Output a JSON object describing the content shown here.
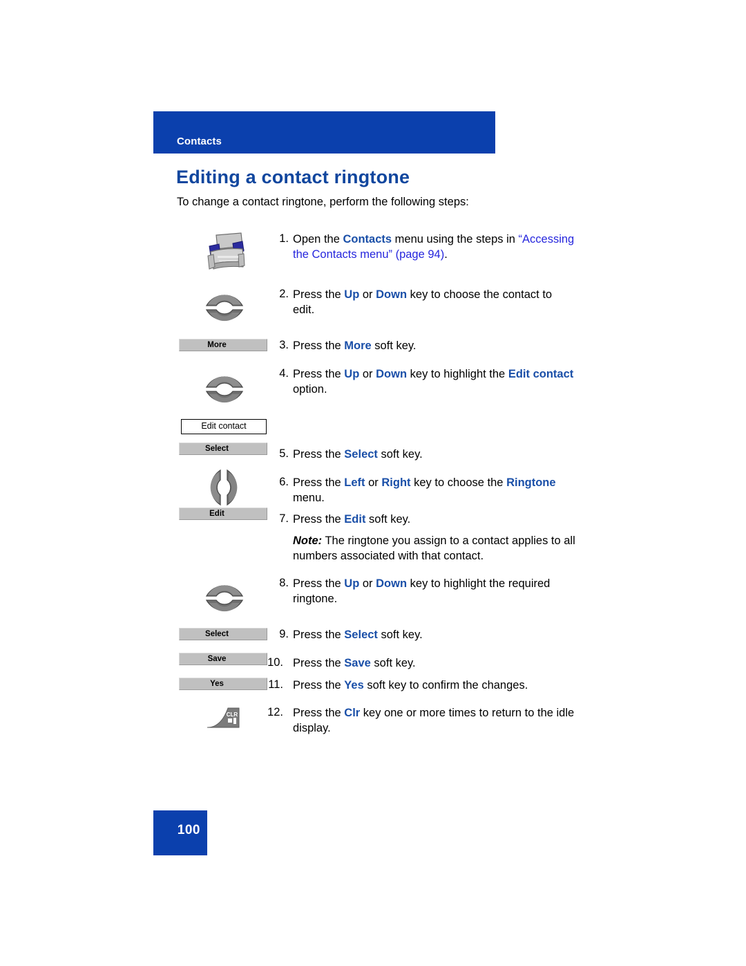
{
  "header": {
    "running_title": "Contacts",
    "bar_color": "#0b40ad"
  },
  "heading": {
    "title": "Editing a contact ringtone",
    "color": "#10469e"
  },
  "intro": "To change a contact ringtone, perform the following steps:",
  "colors": {
    "accent_blue": "#0b40ad",
    "keyword_blue": "#1a4fa8",
    "xref_blue": "#2626dd",
    "softkey_gray": "#c0c0c0",
    "key_art_gray": "#767676"
  },
  "steps": [
    {
      "number": "1.",
      "icon": "rolodex-icon",
      "text_parts": [
        {
          "t": "Open the ",
          "s": "plain"
        },
        {
          "t": "Contacts",
          "s": "bold"
        },
        {
          "t": " menu using the steps in ",
          "s": "plain"
        },
        {
          "t": "“Accessing the Contacts menu” (page 94)",
          "s": "xref"
        },
        {
          "t": ".",
          "s": "plain"
        }
      ]
    },
    {
      "number": "2.",
      "icon": "up-down-navigation-key-icon",
      "text_parts": [
        {
          "t": "Press the ",
          "s": "plain"
        },
        {
          "t": "Up",
          "s": "bold"
        },
        {
          "t": " or ",
          "s": "plain"
        },
        {
          "t": "Down",
          "s": "bold"
        },
        {
          "t": " key to choose the contact to edit.",
          "s": "plain"
        }
      ]
    },
    {
      "number": "3.",
      "icon": "softkey-more",
      "softkey_label": "More",
      "text_parts": [
        {
          "t": "Press the ",
          "s": "plain"
        },
        {
          "t": "More",
          "s": "bold"
        },
        {
          "t": " soft key.",
          "s": "plain"
        }
      ]
    },
    {
      "number": "4.",
      "icon": "up-down-navigation-key-icon",
      "menubox_label": "Edit contact",
      "text_parts": [
        {
          "t": "Press the ",
          "s": "plain"
        },
        {
          "t": "Up",
          "s": "bold"
        },
        {
          "t": " or ",
          "s": "plain"
        },
        {
          "t": "Down",
          "s": "bold"
        },
        {
          "t": " key to highlight the ",
          "s": "plain"
        },
        {
          "t": "Edit contact",
          "s": "bold"
        },
        {
          "t": " option.",
          "s": "plain"
        }
      ]
    },
    {
      "number": "5.",
      "icon": "softkey-select",
      "softkey_label": "Select",
      "text_parts": [
        {
          "t": "Press the ",
          "s": "plain"
        },
        {
          "t": "Select",
          "s": "bold"
        },
        {
          "t": " soft key.",
          "s": "plain"
        }
      ]
    },
    {
      "number": "6.",
      "icon": "left-right-navigation-key-icon",
      "text_parts": [
        {
          "t": "Press the ",
          "s": "plain"
        },
        {
          "t": "Left",
          "s": "bold"
        },
        {
          "t": " or ",
          "s": "plain"
        },
        {
          "t": "Right",
          "s": "bold"
        },
        {
          "t": " key to choose the ",
          "s": "plain"
        },
        {
          "t": "Ringtone",
          "s": "bold"
        },
        {
          "t": " menu.",
          "s": "plain"
        }
      ]
    },
    {
      "number": "7.",
      "icon": "softkey-edit",
      "softkey_label": "Edit",
      "text_parts": [
        {
          "t": "Press the ",
          "s": "plain"
        },
        {
          "t": "Edit",
          "s": "bold"
        },
        {
          "t": " soft key.",
          "s": "plain"
        }
      ]
    },
    {
      "number": "8.",
      "icon": "up-down-navigation-key-icon",
      "text_parts": [
        {
          "t": "Press the ",
          "s": "plain"
        },
        {
          "t": "Up",
          "s": "bold"
        },
        {
          "t": " or ",
          "s": "plain"
        },
        {
          "t": "Down",
          "s": "bold"
        },
        {
          "t": " key to highlight the required ringtone.",
          "s": "plain"
        }
      ]
    },
    {
      "number": "9.",
      "icon": "softkey-select",
      "softkey_label": "Select",
      "text_parts": [
        {
          "t": "Press the ",
          "s": "plain"
        },
        {
          "t": "Select",
          "s": "bold"
        },
        {
          "t": " soft key.",
          "s": "plain"
        }
      ]
    },
    {
      "number": "10.",
      "icon": "softkey-save",
      "softkey_label": "Save",
      "text_parts": [
        {
          "t": "Press the ",
          "s": "plain"
        },
        {
          "t": "Save",
          "s": "bold"
        },
        {
          "t": " soft key.",
          "s": "plain"
        }
      ]
    },
    {
      "number": "11.",
      "icon": "softkey-yes",
      "softkey_label": "Yes",
      "text_parts": [
        {
          "t": "Press the ",
          "s": "plain"
        },
        {
          "t": "Yes",
          "s": "bold"
        },
        {
          "t": " soft key to confirm the changes.",
          "s": "plain"
        }
      ]
    },
    {
      "number": "12.",
      "icon": "clr-key-icon",
      "key_label": "CLR",
      "text_parts": [
        {
          "t": "Press the ",
          "s": "plain"
        },
        {
          "t": "Clr",
          "s": "bold"
        },
        {
          "t": " key one or more times to return to the idle display.",
          "s": "plain"
        }
      ]
    }
  ],
  "note": {
    "lead": "Note:",
    "body": " The ringtone you assign to a contact applies to all numbers associated with that contact."
  },
  "footer": {
    "page_number": "100"
  }
}
